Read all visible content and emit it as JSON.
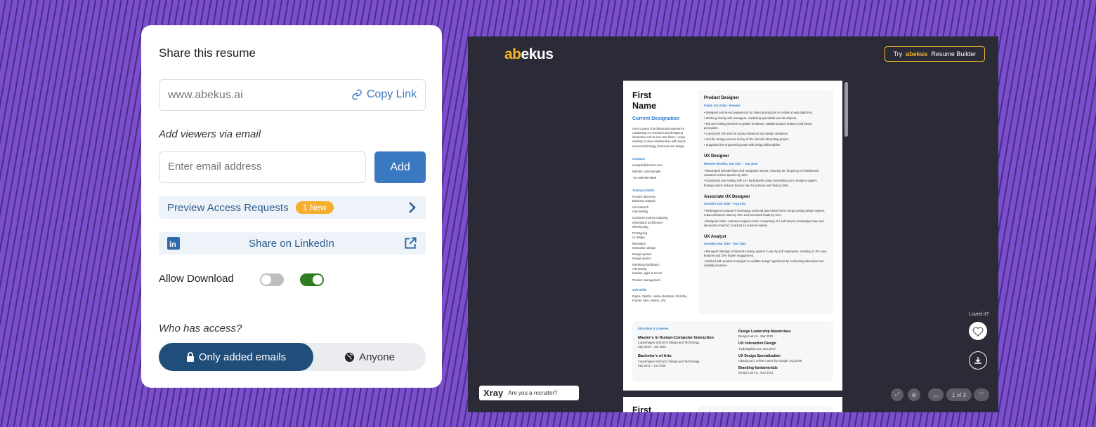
{
  "share_card": {
    "title": "Share this resume",
    "url_value": "www.abekus.ai",
    "copy_link_label": "Copy Link",
    "add_viewers_label": "Add viewers via email",
    "email_placeholder": "Enter email address",
    "add_button": "Add",
    "preview_requests_label": "Preview Access Requests",
    "preview_badge": "1 New",
    "linkedin_label": "Share on LinkedIn",
    "allow_download_label": "Allow Download",
    "toggle_states": [
      false,
      true
    ],
    "who_has_access_label": "Who has access?",
    "access_options": [
      "Only added emails",
      "Anyone"
    ],
    "access_selected": "Only added emails",
    "colors": {
      "primary": "#3a78c2",
      "selected": "#1f4e7a",
      "badge": "#f6ae2d",
      "toggle_on": "#2e7d1f"
    }
  },
  "viewer": {
    "logo": {
      "accent": "ab",
      "rest": "ekus"
    },
    "try_button": {
      "prefix": "Try",
      "brand": "abekus",
      "suffix": "Resume Builder"
    },
    "xray": {
      "brand": "Xray",
      "text": "Are you a recruiter?"
    },
    "loved_it": "Loved it?",
    "page_indicator": "1 of 3",
    "second_page_peek": "First"
  },
  "resume": {
    "first": "First",
    "last": "Name",
    "designation": "Current Designation",
    "summary": "Over 5 years of professional experience conducting UX research and designing interactive end-to-end user flows. I enjoy working in close collaboration with teams across technology, business and design.",
    "contacts_heading": "Contacts",
    "contacts": [
      "example@domain.com",
      "linkedin.com/example",
      "+31 909 909 9909"
    ],
    "tech_heading": "Technical Skills",
    "tech_groups": [
      [
        "Product discovery",
        "Business analysis"
      ],
      [
        "UX research",
        "User testing"
      ],
      [
        "Customer journey mapping",
        "Information architecture",
        "Wireframing"
      ],
      [
        "Prototyping",
        "UI design"
      ],
      [
        "Illustration",
        "Interaction design"
      ],
      [
        "Design system",
        "Design sprints"
      ],
      [
        "Workshop facilitation",
        "A/B testing",
        "Kanban, agile & scrum"
      ],
      [
        "Product management"
      ]
    ],
    "soft_heading": "Soft Skills",
    "soft": "Figma, Sketch, Adobe Illustrator, ProtoPie, Framer, Miro, Notion, Jira",
    "jobs": [
      {
        "title": "Product Designer",
        "date": "Fintel, Oct 2019 – Present",
        "bullets": [
          "• Designed end-to-end experience for financial products on mobile & web platforms.",
          "• Working closely with managers, marketing specialists and developers.",
          "• Did user testing sessions to gather feedback, validate product features and brand perception.",
          "• Conducted A/B tests for product features and design variations.",
          "• Led the design process during of the internal rebranding project.",
          "• Supported the engineering team with design deliverables."
        ]
      },
      {
        "title": "UX Designer",
        "date": "Resume Worded, Sep 2017 – Sep 2019",
        "bullets": [
          "• Revamped website flows and navigation menus, reducing the frequency of misdirected customer service queries by 30%.",
          "• Conducted user testing with 10+ participants using Usertesting.com; designed agains findings which reduced bounce rate for primary user flow by 30%."
        ]
      },
      {
        "title": "Associate UX Designer",
        "date": "Growshi, Dec 2016 – Aug 2017",
        "bullets": [
          "• Redesigned company's homepage and lead generation forms using existing design system; reduced bounce rates by 40% and increased leads by 15%.",
          "• Designed online customer support center comprising of a self-service knowledge base and interactive chat bot. Coached 15 summer interns."
        ]
      },
      {
        "title": "UX Analyst",
        "date": "Growshi, Mar 2015 – Dec 2016",
        "bullets": [
          "• Managed redesign of internal tracking system in use by 125 employees, resulting in 20+ new features and 20% higher engagement.",
          "• Worked with product managers to validate design hypothesis by conducting interviews and usability sessions."
        ]
      }
    ],
    "edu_heading": "Education & Licences",
    "education": [
      {
        "title": "Master's in Human-Computer Interaction",
        "detail": "Copenhagen School of Design and Technology,",
        "date": "Sep 2015 – Jun 2016"
      },
      {
        "title": "Bachelor's of Arts",
        "detail": "Copenhagen School of Design and Technology,",
        "date": "Sep 2011 – Jun 2015"
      }
    ],
    "licences": [
      {
        "title": "Design Leadership Masterclass",
        "detail": "Design Lab Inc., Mar 2020"
      },
      {
        "title": "UX: Interaction Design",
        "detail": "Trydesignlab.com, Dec 2017"
      },
      {
        "title": "UX Design Specialization",
        "detail": "Udacity.com, online course by Google, Aug 2016"
      },
      {
        "title": "Branding fundamentals",
        "detail": "Design Lab Inc., Nov 2014"
      }
    ]
  }
}
